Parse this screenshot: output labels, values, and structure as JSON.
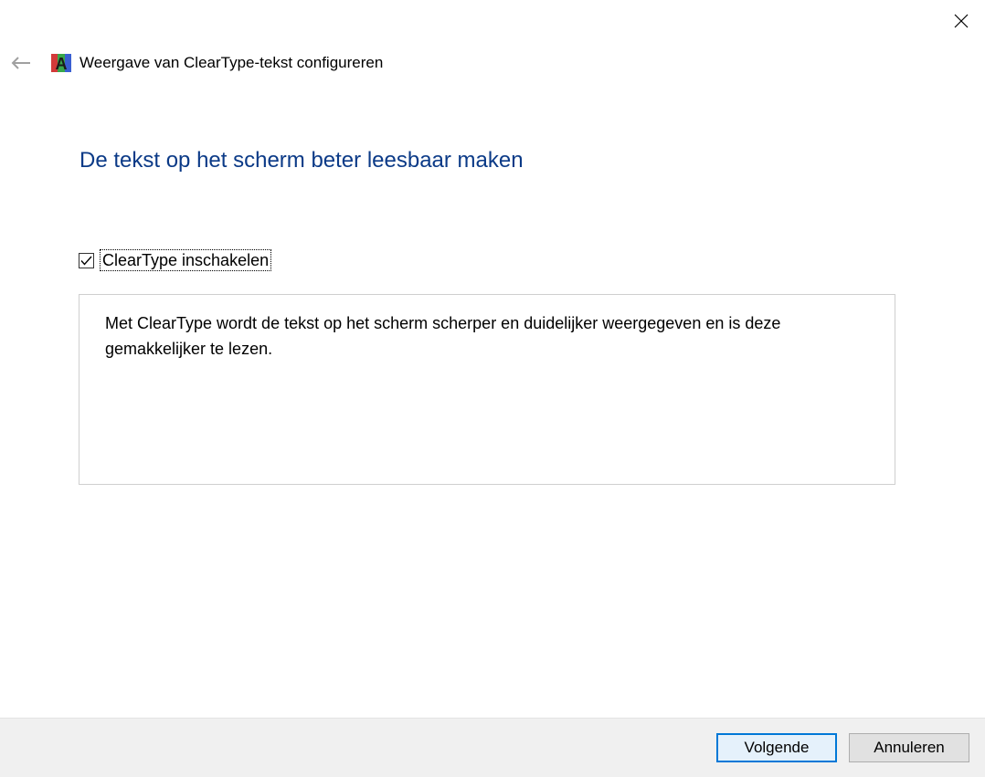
{
  "window": {
    "title": "Weergave van ClearType-tekst configureren",
    "close_icon": "close-icon",
    "back_icon": "back-arrow-icon",
    "app_icon": "cleartype-icon"
  },
  "main": {
    "heading": "De tekst op het scherm beter leesbaar maken",
    "checkbox": {
      "label": "ClearType inschakelen",
      "checked": true
    },
    "description": "Met ClearType wordt de tekst op het scherm scherper en duidelijker weergegeven en is deze gemakkelijker te lezen."
  },
  "footer": {
    "next_label": "Volgende",
    "cancel_label": "Annuleren"
  },
  "colors": {
    "heading": "#0b3a87",
    "focus_border": "#0078d7"
  }
}
